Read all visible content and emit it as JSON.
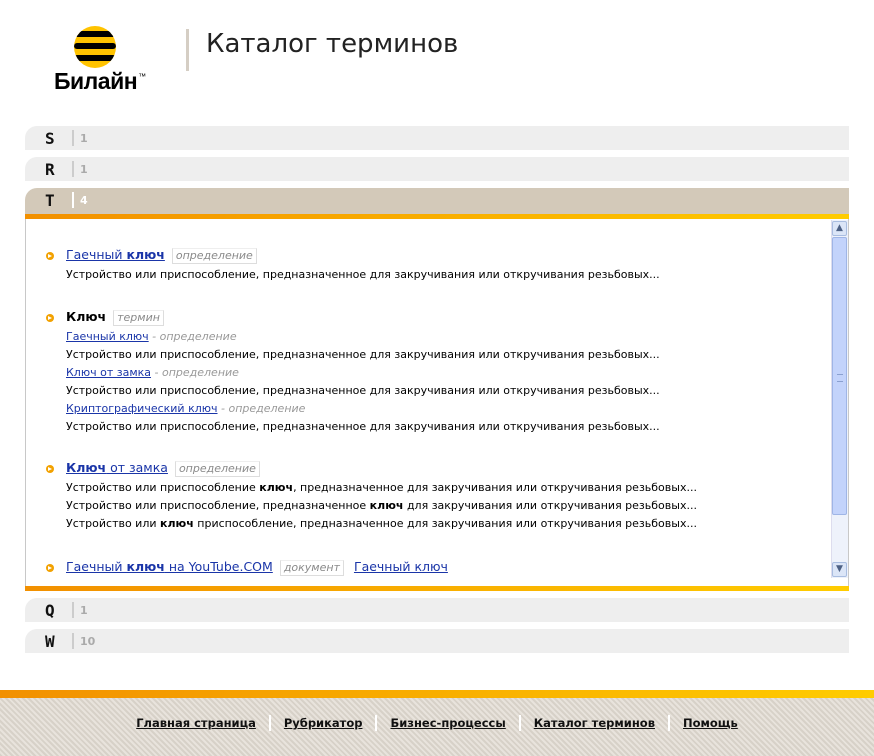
{
  "brand": {
    "logo_text": "Билайн",
    "trademark": "™"
  },
  "header": {
    "title": "Каталог терминов"
  },
  "letters_top": [
    {
      "letter": "S",
      "count": "1"
    },
    {
      "letter": "R",
      "count": "1"
    },
    {
      "letter": "T",
      "count": "4"
    }
  ],
  "letters_bottom": [
    {
      "letter": "Q",
      "count": "1"
    },
    {
      "letter": "W",
      "count": "10"
    }
  ],
  "entries": {
    "e1": {
      "link_pre": "Гаечный ",
      "link_bold": "ключ",
      "tag": "определение",
      "desc": "Устройство или приспособление, предназначенное для закручивания или откручивания резьбовых..."
    },
    "e2": {
      "title": "Ключ",
      "tag": "термин",
      "subs": [
        {
          "link": "Гаечный ключ",
          "kind": " - определение",
          "desc": "Устройство или приспособление, предназначенное для закручивания или откручивания резьбовых..."
        },
        {
          "link": "Ключ от замка",
          "kind": " - определение",
          "desc": "Устройство или приспособление, предназначенное для закручивания или откручивания резьбовых..."
        },
        {
          "link": "Криптографический ключ",
          "kind": " - определение",
          "desc": "Устройство или приспособление, предназначенное для закручивания или откручивания резьбовых..."
        }
      ]
    },
    "e3": {
      "link_bold": "Ключ",
      "link_post": " от замка",
      "tag": "определение",
      "d1_pre": "Устройство или приспособление ",
      "d1_bold": "ключ",
      "d1_post": ", предназначенное для закручивания или откручивания резьбовых...",
      "d2_pre": "Устройство или приспособление, предназначенное ",
      "d2_bold": "ключ",
      "d2_post": " для закручивания или откручивания резьбовых...",
      "d3_pre": "Устройство или ",
      "d3_bold": "ключ",
      "d3_post": " приспособление, предназначенное для закручивания или откручивания резьбовых..."
    },
    "e4": {
      "link_pre": "Гаечный ",
      "link_bold": "ключ",
      "link_post": " на YouTube.COM",
      "tag": "документ",
      "extra_link": "Гаечный ключ"
    }
  },
  "footer": {
    "links": [
      "Главная страница",
      "Рубрикатор",
      "Бизнес-процессы",
      "Каталог терминов",
      "Помощь"
    ]
  },
  "colors": {
    "accent_orange": "#f29000",
    "accent_yellow": "#ffcc00",
    "link": "#1a35a8",
    "active_row": "#d3c9b9"
  }
}
